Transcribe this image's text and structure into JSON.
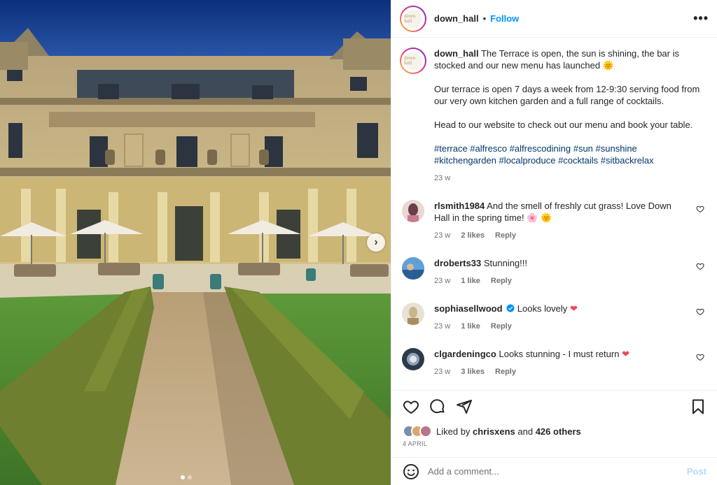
{
  "post": {
    "username": "down_hall",
    "separator": "•",
    "follow_label": "Follow",
    "more_icon": "more-horizontal-icon",
    "avatar_text": "down hall",
    "caption": {
      "username": "down_hall",
      "line1": "The Terrace is open, the sun is shining, the bar is stocked and our new menu has launched",
      "line1_emoji": "🌞",
      "para2": "Our terrace is open 7 days a week from 12-9:30 serving food from our very own kitchen garden and a full range of cocktails.",
      "para3": "Head to our website to check out our menu and book your table.",
      "hashtags": "#terrace #alfresco #alfrescodining #sun #sunshine #kitchengarden #localproduce #cocktails #sitbackrelax",
      "time": "23 w"
    },
    "comments": [
      {
        "username": "rlsmith1984",
        "text": "And the smell of freshly cut grass! Love Down Hall in the spring time!",
        "emoji": "🌸 🌞",
        "time": "23 w",
        "likes": "2 likes",
        "reply": "Reply",
        "avatar_color": "#6b3e4b"
      },
      {
        "username": "droberts33",
        "text": "Stunning!!!",
        "emoji": "",
        "time": "23 w",
        "likes": "1 like",
        "reply": "Reply",
        "avatar_color": "#3a6ea8"
      },
      {
        "username": "sophiasellwood",
        "text": "Looks lovely",
        "emoji": "❤",
        "time": "23 w",
        "likes": "1 like",
        "reply": "Reply",
        "avatar_color": "#c9b58c",
        "verified": true
      },
      {
        "username": "clgardeningco",
        "text": "Looks stunning - I must return",
        "emoji": "❤",
        "time": "23 w",
        "likes": "3 likes",
        "reply": "Reply",
        "avatar_color": "#2c3a4a"
      }
    ],
    "likes": {
      "prefix": "Liked by",
      "user": "chrisxens",
      "and": "and",
      "others": "426 others"
    },
    "date": "4 APRIL",
    "add_comment": {
      "placeholder": "Add a comment...",
      "post_label": "Post"
    },
    "carousel": {
      "next_label": "›",
      "slides": 2,
      "active_slide": 1
    }
  },
  "colors": {
    "accent": "#0095f6",
    "heart_red": "#ed4956",
    "hashtag": "#00376b",
    "muted": "#737373"
  }
}
